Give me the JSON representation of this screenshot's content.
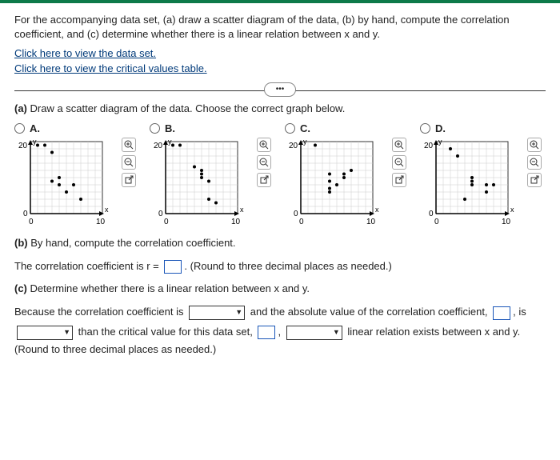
{
  "prompt": "For the accompanying data set, (a) draw a scatter diagram of the data, (b) by hand, compute the correlation coefficient, and (c) determine whether there is a linear relation between x and y.",
  "links": {
    "dataset": "Click here to view the data set.",
    "critvals": "Click here to view the critical values table."
  },
  "more": "•••",
  "partA": {
    "label": "(a)",
    "text": "Draw a scatter diagram of the data. Choose the correct graph below."
  },
  "options": {
    "A": "A.",
    "B": "B.",
    "C": "C.",
    "D": "D."
  },
  "axis": {
    "ylabel": "y",
    "xlabel": "x",
    "ymax": "20",
    "ymin": "0",
    "xmin": "0",
    "xmax": "10"
  },
  "tools": {
    "zoomin": "zoom-in",
    "zoomout": "zoom-out",
    "popout": "popout"
  },
  "partB": {
    "label": "(b)",
    "text": "By hand, compute the correlation coefficient.",
    "line": "The correlation coefficient is r =",
    "round": "(Round to three decimal places as needed.)"
  },
  "partC": {
    "label": "(c)",
    "text": "Determine whether there is a linear relation between x and y.",
    "seg1": "Because the correlation coefficient is",
    "seg2": "and the absolute value of the correlation coefficient,",
    "seg3": ", is",
    "seg4": "than the critical value for this data set,",
    "seg5": ",",
    "seg6": "linear relation exists between x and y.",
    "round": "(Round to three decimal places as needed.)"
  },
  "chart_data": [
    {
      "option": "A",
      "type": "scatter",
      "xlabel": "x",
      "ylabel": "y",
      "xlim": [
        0,
        10
      ],
      "ylim": [
        0,
        20
      ],
      "points": [
        [
          1,
          19
        ],
        [
          2,
          19
        ],
        [
          3,
          17
        ],
        [
          3,
          9
        ],
        [
          4,
          8
        ],
        [
          4,
          10
        ],
        [
          5,
          6
        ],
        [
          6,
          8
        ],
        [
          7,
          4
        ]
      ]
    },
    {
      "option": "B",
      "type": "scatter",
      "xlabel": "x",
      "ylabel": "y",
      "xlim": [
        0,
        10
      ],
      "ylim": [
        0,
        20
      ],
      "points": [
        [
          1,
          19
        ],
        [
          2,
          19
        ],
        [
          4,
          13
        ],
        [
          5,
          10
        ],
        [
          5,
          11
        ],
        [
          5,
          12
        ],
        [
          6,
          9
        ],
        [
          6,
          4
        ],
        [
          7,
          3
        ]
      ]
    },
    {
      "option": "C",
      "type": "scatter",
      "xlabel": "x",
      "ylabel": "y",
      "xlim": [
        0,
        10
      ],
      "ylim": [
        0,
        20
      ],
      "points": [
        [
          2,
          19
        ],
        [
          4,
          6
        ],
        [
          4,
          7
        ],
        [
          4,
          9
        ],
        [
          4,
          11
        ],
        [
          5,
          8
        ],
        [
          6,
          10
        ],
        [
          6,
          11
        ],
        [
          7,
          12
        ]
      ]
    },
    {
      "option": "D",
      "type": "scatter",
      "xlabel": "x",
      "ylabel": "y",
      "xlim": [
        0,
        10
      ],
      "ylim": [
        0,
        20
      ],
      "points": [
        [
          2,
          18
        ],
        [
          3,
          16
        ],
        [
          4,
          4
        ],
        [
          5,
          8
        ],
        [
          5,
          9
        ],
        [
          5,
          10
        ],
        [
          7,
          6
        ],
        [
          7,
          8
        ],
        [
          8,
          8
        ]
      ]
    }
  ]
}
